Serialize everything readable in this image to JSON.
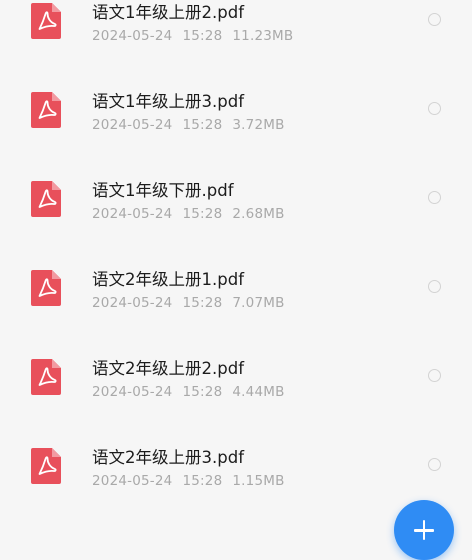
{
  "files": [
    {
      "name": "语文1年级上册2.pdf",
      "date": "2024-05-24",
      "time": "15:28",
      "size": "11.23MB",
      "icon": "pdf-icon"
    },
    {
      "name": "语文1年级上册3.pdf",
      "date": "2024-05-24",
      "time": "15:28",
      "size": "3.72MB",
      "icon": "pdf-icon"
    },
    {
      "name": "语文1年级下册.pdf",
      "date": "2024-05-24",
      "time": "15:28",
      "size": "2.68MB",
      "icon": "pdf-icon"
    },
    {
      "name": "语文2年级上册1.pdf",
      "date": "2024-05-24",
      "time": "15:28",
      "size": "7.07MB",
      "icon": "pdf-icon"
    },
    {
      "name": "语文2年级上册2.pdf",
      "date": "2024-05-24",
      "time": "15:28",
      "size": "4.44MB",
      "icon": "pdf-icon"
    },
    {
      "name": "语文2年级上册3.pdf",
      "date": "2024-05-24",
      "time": "15:28",
      "size": "1.15MB",
      "icon": "pdf-icon"
    }
  ],
  "colors": {
    "pdf_icon": "#e8505b",
    "fab": "#2f8cf4",
    "title_text": "#1c1c1c",
    "meta_text": "#a9a9a9"
  },
  "fab": {
    "icon": "plus-icon"
  }
}
